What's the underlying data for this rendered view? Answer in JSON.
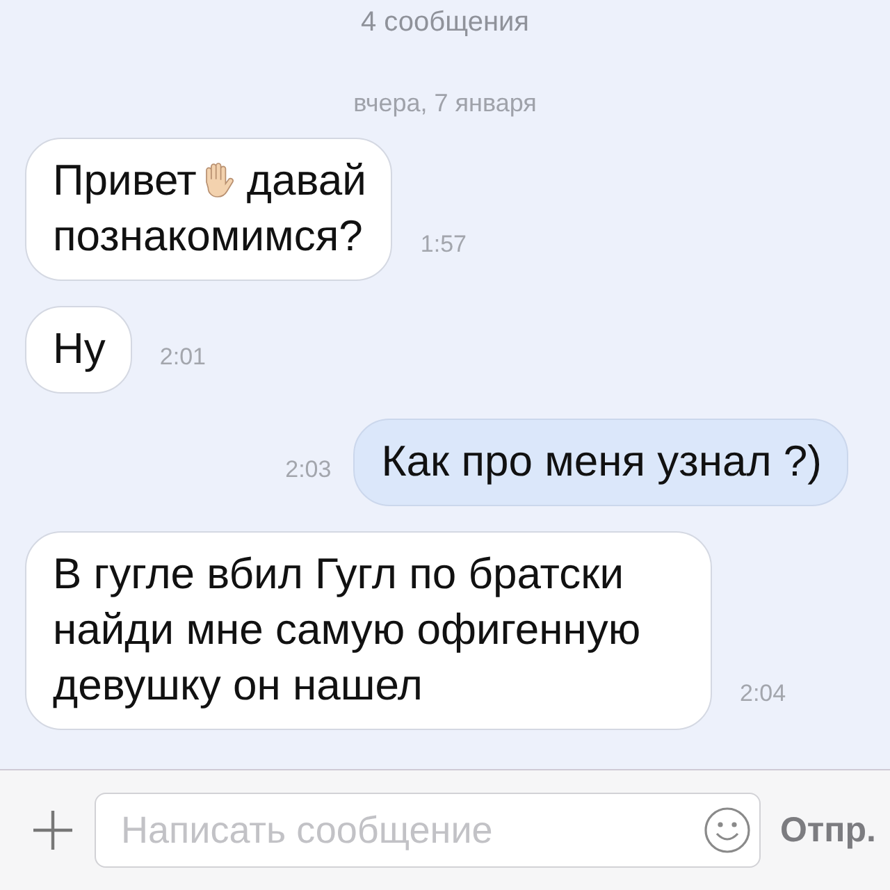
{
  "header": {
    "count": "4 сообщения",
    "date": "вчера, 7 января"
  },
  "messages": [
    {
      "kind": "incoming",
      "time": "1:57",
      "parts": [
        {
          "kind": "text",
          "text": "Привет"
        },
        {
          "kind": "hand"
        },
        {
          "kind": "text",
          "text": "давай"
        },
        {
          "kind": "break"
        },
        {
          "kind": "text",
          "text": "познакомимся?"
        }
      ]
    },
    {
      "kind": "incoming",
      "time": "2:01",
      "parts": [
        {
          "kind": "text",
          "text": "Ну"
        }
      ]
    },
    {
      "kind": "outgoing",
      "time": "2:03",
      "parts": [
        {
          "kind": "text",
          "text": "Как про меня узнал ?)"
        }
      ]
    },
    {
      "kind": "incoming",
      "time": "2:04",
      "parts": [
        {
          "kind": "text",
          "text": "В гугле вбил Гугл по братски найди мне самую офигенную девушку он нашел"
        }
      ]
    }
  ],
  "composer": {
    "placeholder": "Написать сообщение",
    "send": "Отпр."
  }
}
